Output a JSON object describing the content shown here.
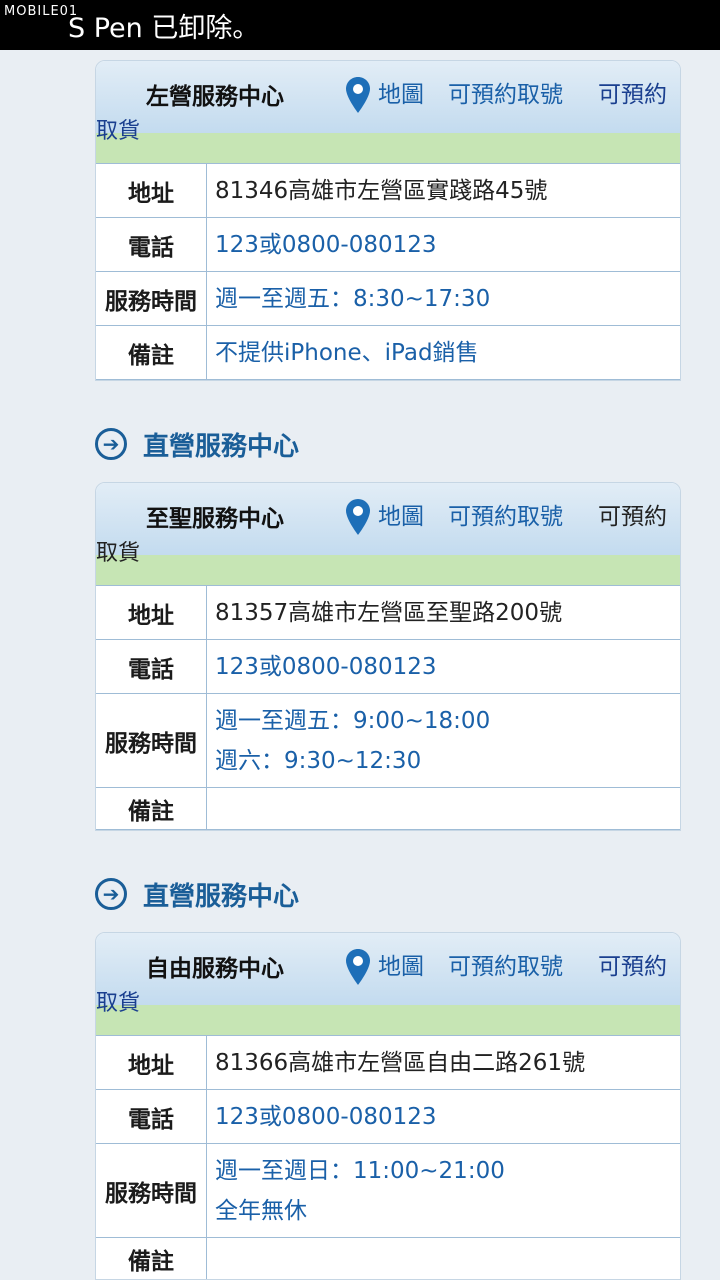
{
  "status_bar": {
    "logo": "MOBILE01",
    "toast": "S Pen 已卸除。"
  },
  "sections": [
    {
      "heading": "",
      "name": "左營服務中心",
      "map_label": "地圖",
      "queue_label": "可預約取號",
      "pickup_line1": "可預約",
      "pickup_line2": "取貨",
      "fields": [
        {
          "label": "地址",
          "lines": [
            "81346高雄市左營區實踐路45號"
          ]
        },
        {
          "label": "電話",
          "lines": [
            "123或0800-080123"
          ]
        },
        {
          "label": "服務時間",
          "lines": [
            "週一至週五：8:30~17:30"
          ]
        },
        {
          "label": "備註",
          "lines": [
            "不提供iPhone、iPad銷售"
          ]
        }
      ]
    },
    {
      "heading": "直營服務中心",
      "name": "至聖服務中心",
      "map_label": "地圖",
      "queue_label": "可預約取號",
      "pickup_line1": "可預約",
      "pickup_line2": "取貨",
      "fields": [
        {
          "label": "地址",
          "lines": [
            "81357高雄市左營區至聖路200號"
          ]
        },
        {
          "label": "電話",
          "lines": [
            "123或0800-080123"
          ]
        },
        {
          "label": "服務時間",
          "lines": [
            "週一至週五：9:00~18:00",
            "週六：9:30~12:30"
          ]
        },
        {
          "label": "備註",
          "lines": [
            ""
          ]
        }
      ]
    },
    {
      "heading": "直營服務中心",
      "name": "自由服務中心",
      "map_label": "地圖",
      "queue_label": "可預約取號",
      "pickup_line1": "可預約",
      "pickup_line2": "取貨",
      "fields": [
        {
          "label": "地址",
          "lines": [
            "81366高雄市左營區自由二路261號"
          ]
        },
        {
          "label": "電話",
          "lines": [
            "123或0800-080123"
          ]
        },
        {
          "label": "服務時間",
          "lines": [
            "週一至週日：11:00~21:00",
            "全年無休"
          ]
        },
        {
          "label": "備註",
          "lines": [
            ""
          ]
        }
      ]
    }
  ],
  "colors": {
    "link": "#1a60a8",
    "heading": "#1a5e98",
    "green_bar": "#c6e5b4"
  }
}
